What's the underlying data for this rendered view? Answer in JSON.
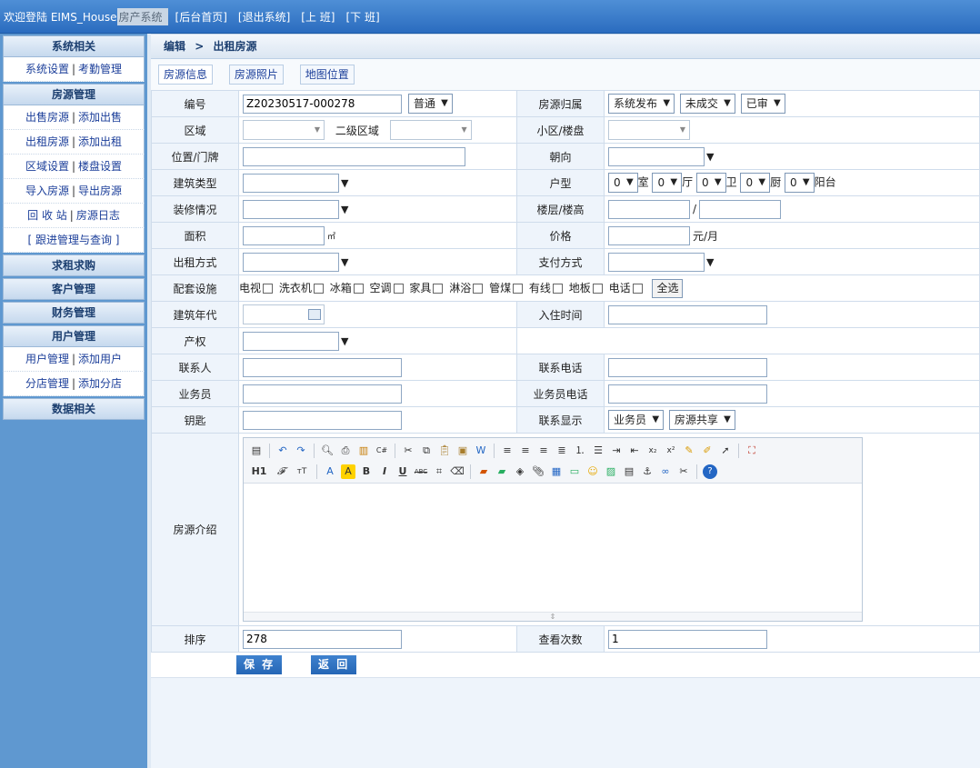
{
  "topbar": {
    "welcome": "欢迎登陆 EIMS_House",
    "system_name": "房产系统",
    "links": [
      "[后台首页]",
      "[退出系统]",
      "[上 班]",
      "[下 班]"
    ]
  },
  "sidebar": {
    "sys_header": "系统相关",
    "sys_item_a": "系统设置",
    "sys_item_b": "考勤管理",
    "house_header": "房源管理",
    "h1a": "出售房源",
    "h1b": "添加出售",
    "h2a": "出租房源",
    "h2b": "添加出租",
    "h3a": "区域设置",
    "h3b": "楼盘设置",
    "h4a": "导入房源",
    "h4b": "导出房源",
    "h5a": "回 收 站",
    "h5b": "房源日志",
    "h6": "[ 跟进管理与查询 ]",
    "rent_header": "求租求购",
    "cust_header": "客户管理",
    "fin_header": "财务管理",
    "user_header": "用户管理",
    "u1a": "用户管理",
    "u1b": "添加用户",
    "u2a": "分店管理",
    "u2b": "添加分店",
    "data_header": "数据相关",
    "sep": "|"
  },
  "breadcrumb": {
    "part1": "编辑",
    "arrow": ">",
    "part2": "出租房源"
  },
  "tabs": [
    "房源信息",
    "房源照片",
    "地图位置"
  ],
  "form": {
    "code_label": "编号",
    "code_value": "Z20230517-000278",
    "code_type": "普通",
    "owner_label": "房源归属",
    "owner_a": "系统发布",
    "owner_b": "未成交",
    "owner_c": "已审",
    "area_label": "区域",
    "subarea_label": "二级区域",
    "estate_label": "小区/楼盘",
    "location_label": "位置/门牌",
    "orient_label": "朝向",
    "building_label": "建筑类型",
    "layout_label": "户型",
    "layout_units": [
      "室",
      "厅",
      "卫",
      "厨",
      "阳台"
    ],
    "layout_values": [
      "0",
      "0",
      "0",
      "0",
      "0"
    ],
    "decor_label": "装修情况",
    "floor_label": "楼层/楼高",
    "floor_sep": "/",
    "size_label": "面积",
    "size_unit": "㎡",
    "price_label": "价格",
    "price_unit": "元/月",
    "renttype_label": "出租方式",
    "pay_label": "支付方式",
    "facilities_label": "配套设施",
    "facilities": [
      "电视",
      "洗衣机",
      "冰箱",
      "空调",
      "家具",
      "淋浴",
      "管煤",
      "有线",
      "地板",
      "电话"
    ],
    "select_all": "全选",
    "year_label": "建筑年代",
    "checkin_label": "入住时间",
    "property_label": "产权",
    "contact_label": "联系人",
    "phone_label": "联系电话",
    "agent_label": "业务员",
    "agentphone_label": "业务员电话",
    "key_label": "钥匙",
    "display_label": "联系显示",
    "display_a": "业务员",
    "display_b": "房源共享",
    "intro_label": "房源介绍",
    "sort_label": "排序",
    "sort_value": "278",
    "views_label": "查看次数",
    "views_value": "1"
  },
  "editor": {
    "row1_icons": [
      "source-icon",
      "undo-icon",
      "redo-icon",
      "preview-icon",
      "print-icon",
      "template-icon",
      "code-icon",
      "cut-icon",
      "copy-icon",
      "paste-icon",
      "paste-text-icon",
      "paste-word-icon",
      "align-left-icon",
      "align-center-icon",
      "align-right-icon",
      "align-justify-icon",
      "ordered-list-icon",
      "unordered-list-icon",
      "indent-icon",
      "outdent-icon",
      "subscript-icon",
      "superscript-icon",
      "clear-format-icon",
      "select-all-icon",
      "cursor-icon",
      "fullscreen-icon"
    ],
    "row2_labels": [
      "H1",
      "𝓕",
      "тT",
      "A",
      "A",
      "B",
      "I",
      "U",
      "ABC"
    ],
    "row2_icons": [
      "table-icon",
      "erase-icon",
      "image-icon",
      "flash-icon",
      "media-icon",
      "attach-icon",
      "insert-table-icon",
      "hr-icon",
      "emoticon-icon",
      "map-icon",
      "pagebreak-icon",
      "anchor-icon",
      "link-icon",
      "unlink-icon",
      "help-icon"
    ]
  },
  "buttons": {
    "save": "保 存",
    "back": "返 回"
  },
  "colors": {
    "topbar": "#2a6cbf",
    "sidebar": "#5f98d0",
    "button": "#2566b5"
  }
}
